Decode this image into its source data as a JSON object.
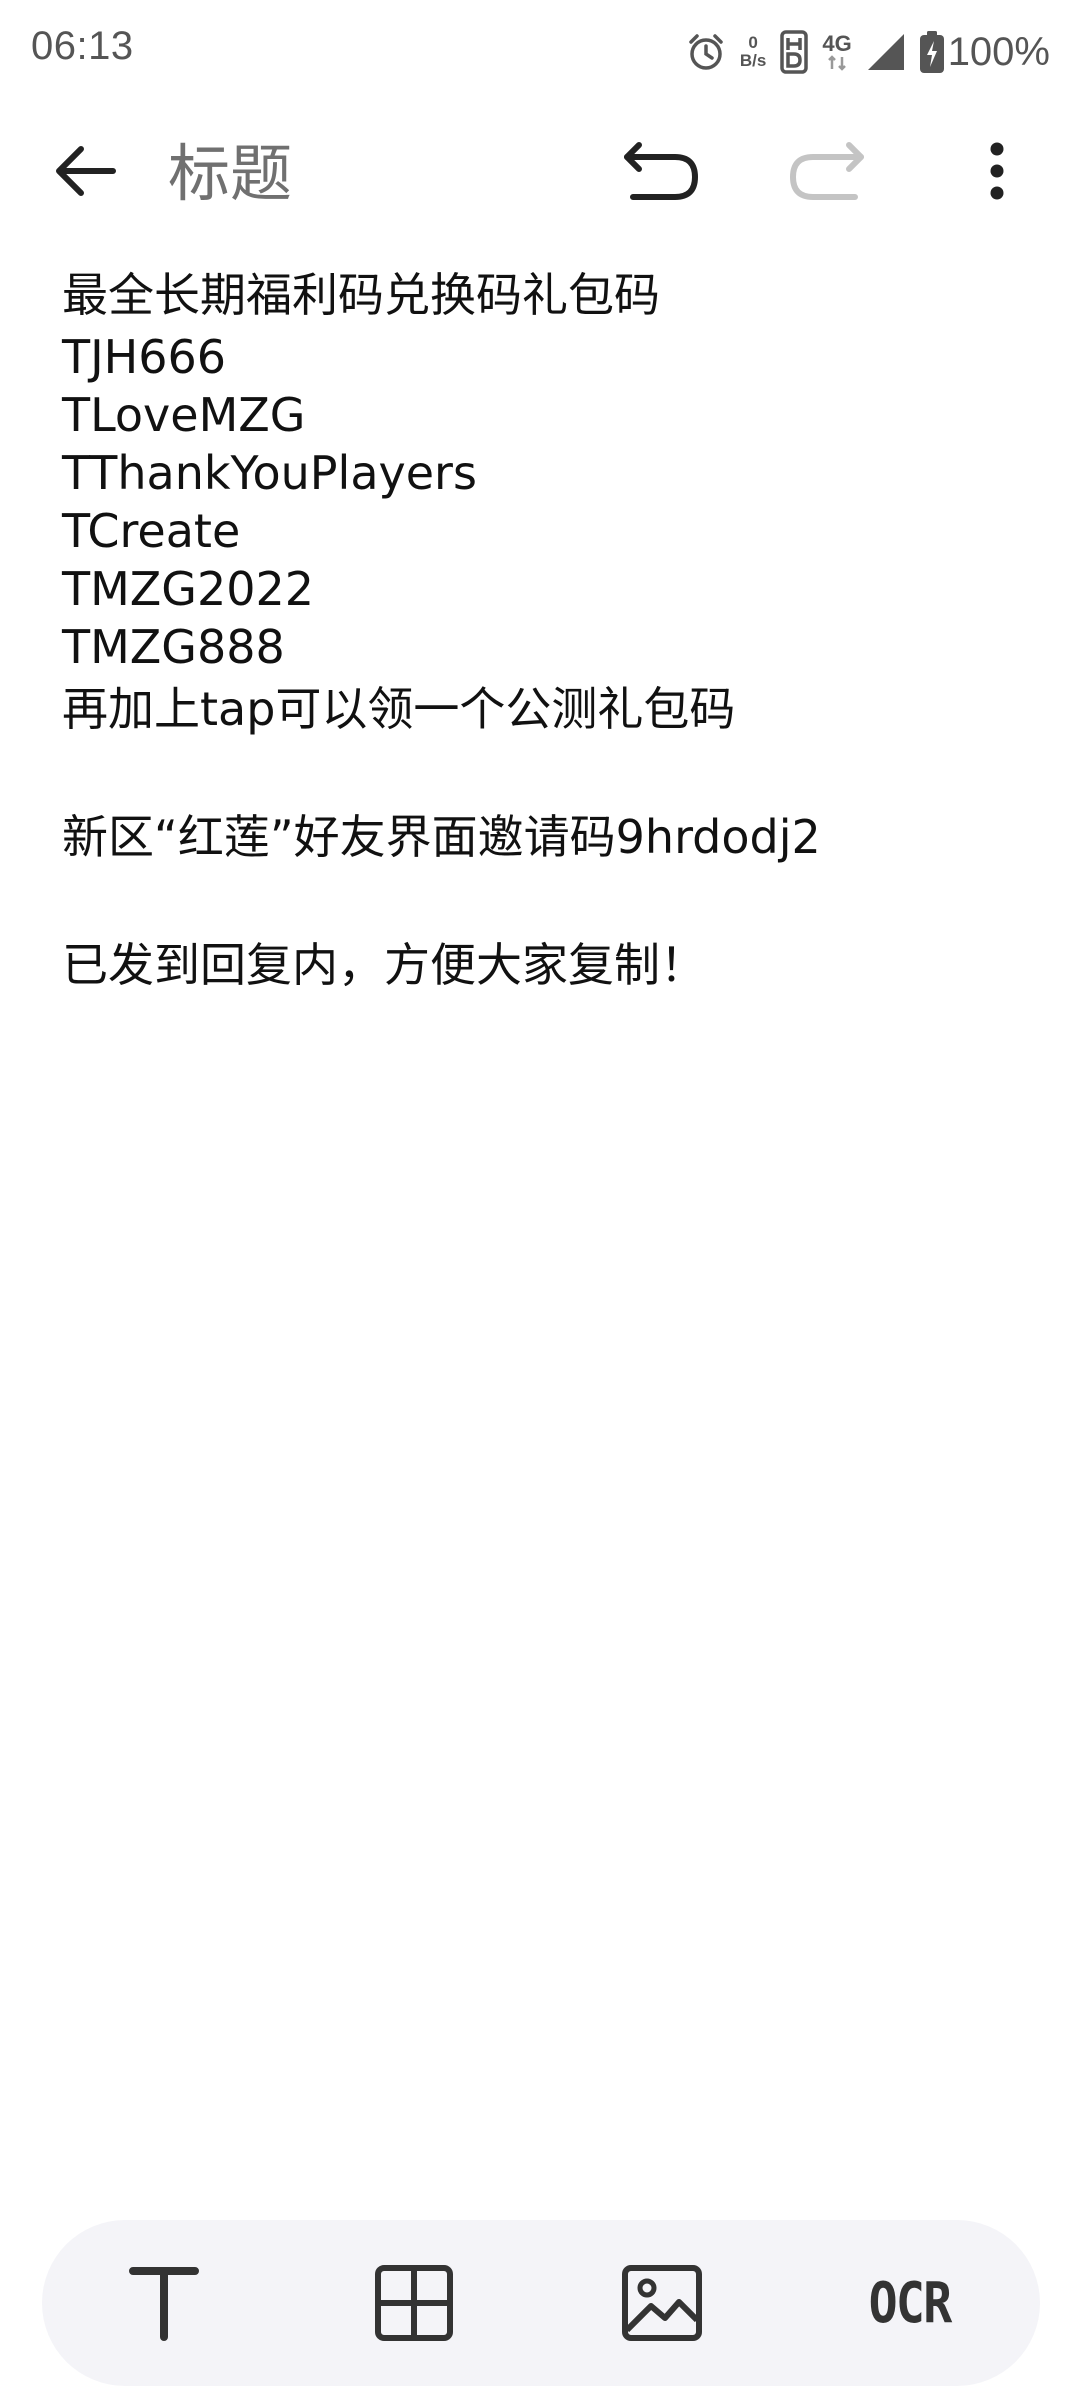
{
  "status_bar": {
    "time": "06:13",
    "net_speed_value": "0",
    "net_speed_unit": "B/s",
    "network_type": "4G",
    "battery_percent": "100%",
    "icons": [
      "alarm-icon",
      "hd-icon",
      "signal-icon",
      "battery-charging-icon"
    ]
  },
  "toolbar": {
    "title_placeholder": "标题",
    "icons": [
      "back-arrow-icon",
      "undo-icon",
      "redo-icon",
      "more-vert-icon"
    ]
  },
  "note": {
    "lines": [
      "最全长期福利码兑换码礼包码",
      "TJH666",
      "TLoveMZG",
      "TThankYouPlayers",
      "TCreate",
      "TMZG2022",
      "TMZG888",
      "再加上tap可以领一个公测礼包码",
      "",
      "新区“红莲”好友界面邀请码9hrdodj2",
      "",
      "已发到回复内，方便大家复制！"
    ]
  },
  "bottom_toolbar": {
    "ocr_label": "OCR",
    "icons": [
      "text-format-icon",
      "table-icon",
      "image-icon",
      "ocr-icon"
    ]
  },
  "colors": {
    "background": "#ffffff",
    "bottom_bar": "#f4f4f8",
    "icon_dark": "#222222",
    "icon_disabled": "#c4c4c4",
    "title_placeholder": "#707070"
  }
}
